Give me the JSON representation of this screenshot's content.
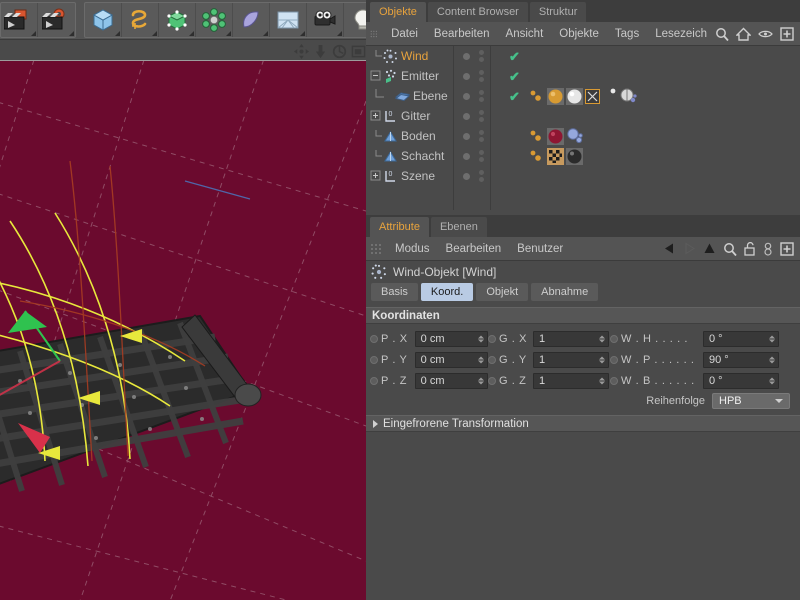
{
  "toolbar": {
    "groups": [
      {
        "name": "render-group",
        "buttons": [
          {
            "name": "render-view-button",
            "icon": "clapperboard-render-icon"
          },
          {
            "name": "render-settings-button",
            "icon": "clapperboard-gear-icon"
          }
        ]
      },
      {
        "name": "objects-group",
        "buttons": [
          {
            "name": "add-cube-button",
            "icon": "cube-icon"
          },
          {
            "name": "add-spline-button",
            "icon": "spline-icon"
          },
          {
            "name": "add-generator-button",
            "icon": "hypernurbs-icon"
          },
          {
            "name": "add-array-button",
            "icon": "array-icon"
          },
          {
            "name": "add-deformer-button",
            "icon": "bend-deformer-icon"
          },
          {
            "name": "add-scene-button",
            "icon": "floor-environment-icon"
          },
          {
            "name": "add-camera-button",
            "icon": "camera-icon"
          },
          {
            "name": "add-light-button",
            "icon": "light-bulb-icon"
          }
        ]
      }
    ]
  },
  "viewport": {
    "nav_icons": [
      {
        "name": "viewport-move-icon",
        "icon": "move-arrows-icon"
      },
      {
        "name": "viewport-zoom-icon",
        "icon": "down-arrow-icon"
      },
      {
        "name": "viewport-rotate-icon",
        "icon": "rotate-icon"
      },
      {
        "name": "viewport-maximize-icon",
        "icon": "maximize-panel-icon"
      }
    ],
    "background_color": "#6b0a2e",
    "grid_color": "#9d6278",
    "grate_color": "#2c2c2c",
    "gizmo_color": "#e8e83c",
    "axis_x_color": "#d8314a",
    "axis_y_color": "#2fc24f"
  },
  "object_manager": {
    "tabs": [
      {
        "label": "Objekte",
        "active": true
      },
      {
        "label": "Content Browser",
        "active": false
      },
      {
        "label": "Struktur",
        "active": false
      }
    ],
    "menu": [
      "Datei",
      "Bearbeiten",
      "Ansicht",
      "Objekte",
      "Tags",
      "Lesezeich"
    ],
    "menu_icons": [
      {
        "name": "search-icon"
      },
      {
        "name": "home-icon"
      },
      {
        "name": "eye-icon"
      },
      {
        "name": "plus-box-icon"
      }
    ],
    "rows": [
      {
        "label": "Wind",
        "icon": "wind-object-icon",
        "selected": true,
        "indent": 1,
        "expander": "none",
        "check": true,
        "tags": []
      },
      {
        "label": "Emitter",
        "icon": "emitter-object-icon",
        "selected": false,
        "indent": 0,
        "expander": "collapse",
        "check": true,
        "tags": []
      },
      {
        "label": "Ebene",
        "icon": "plane-object-icon",
        "selected": false,
        "indent": 2,
        "expander": "none",
        "check": true,
        "tags": [
          "dots-tag",
          "orange-material-tag",
          "white-material-tag",
          "texture-axis-tag",
          "dots-tag-2",
          "phong-tag"
        ]
      },
      {
        "label": "Gitter",
        "icon": "null-object-icon",
        "selected": false,
        "indent": 0,
        "expander": "expand",
        "check": false,
        "tags": []
      },
      {
        "label": "Boden",
        "icon": "floor-object-icon",
        "selected": false,
        "indent": 1,
        "expander": "none",
        "check": false,
        "tags": [
          "dots-tag",
          "red-material-tag",
          "blue-compositing-tag"
        ]
      },
      {
        "label": "Schacht",
        "icon": "floor-object-icon",
        "selected": false,
        "indent": 1,
        "expander": "none",
        "check": false,
        "tags": [
          "dots-tag",
          "checker-material-tag",
          "dark-material-tag"
        ]
      },
      {
        "label": "Szene",
        "icon": "null-object-icon",
        "selected": false,
        "indent": 0,
        "expander": "expand",
        "check": false,
        "tags": []
      }
    ]
  },
  "attribute_manager": {
    "tabs": [
      {
        "label": "Attribute",
        "active": true
      },
      {
        "label": "Ebenen",
        "active": false
      }
    ],
    "menu": [
      "Modus",
      "Bearbeiten",
      "Benutzer"
    ],
    "menu_icons": [
      {
        "name": "back-arrow-icon"
      },
      {
        "name": "forward-arrow-icon"
      },
      {
        "name": "up-arrow-icon"
      },
      {
        "name": "search-icon"
      },
      {
        "name": "unlock-padlock-icon"
      },
      {
        "name": "link-chain-icon"
      },
      {
        "name": "plus-box-icon"
      }
    ],
    "object_title": "Wind-Objekt [Wind]",
    "object_icon": "wind-object-icon",
    "sub_tabs": [
      {
        "label": "Basis",
        "active": false
      },
      {
        "label": "Koord.",
        "active": true
      },
      {
        "label": "Objekt",
        "active": false
      },
      {
        "label": "Abnahme",
        "active": false
      }
    ],
    "coordinates": {
      "section_title": "Koordinaten",
      "rows": [
        {
          "pos_label": "P . X",
          "pos_value": "0 cm",
          "size_label": "G . X",
          "size_value": "1",
          "rot_label": "W . H . . . . .",
          "rot_value": "0 °"
        },
        {
          "pos_label": "P . Y",
          "pos_value": "0 cm",
          "size_label": "G . Y",
          "size_value": "1",
          "rot_label": "W . P . . . . . .",
          "rot_value": "90 °"
        },
        {
          "pos_label": "P . Z",
          "pos_value": "0 cm",
          "size_label": "G . Z",
          "size_value": "1",
          "rot_label": "W . B . . . . . .",
          "rot_value": "0 °"
        }
      ],
      "order_label": "Reihenfolge",
      "order_value": "HPB"
    },
    "frozen_section": "Eingefrorene Transformation"
  }
}
